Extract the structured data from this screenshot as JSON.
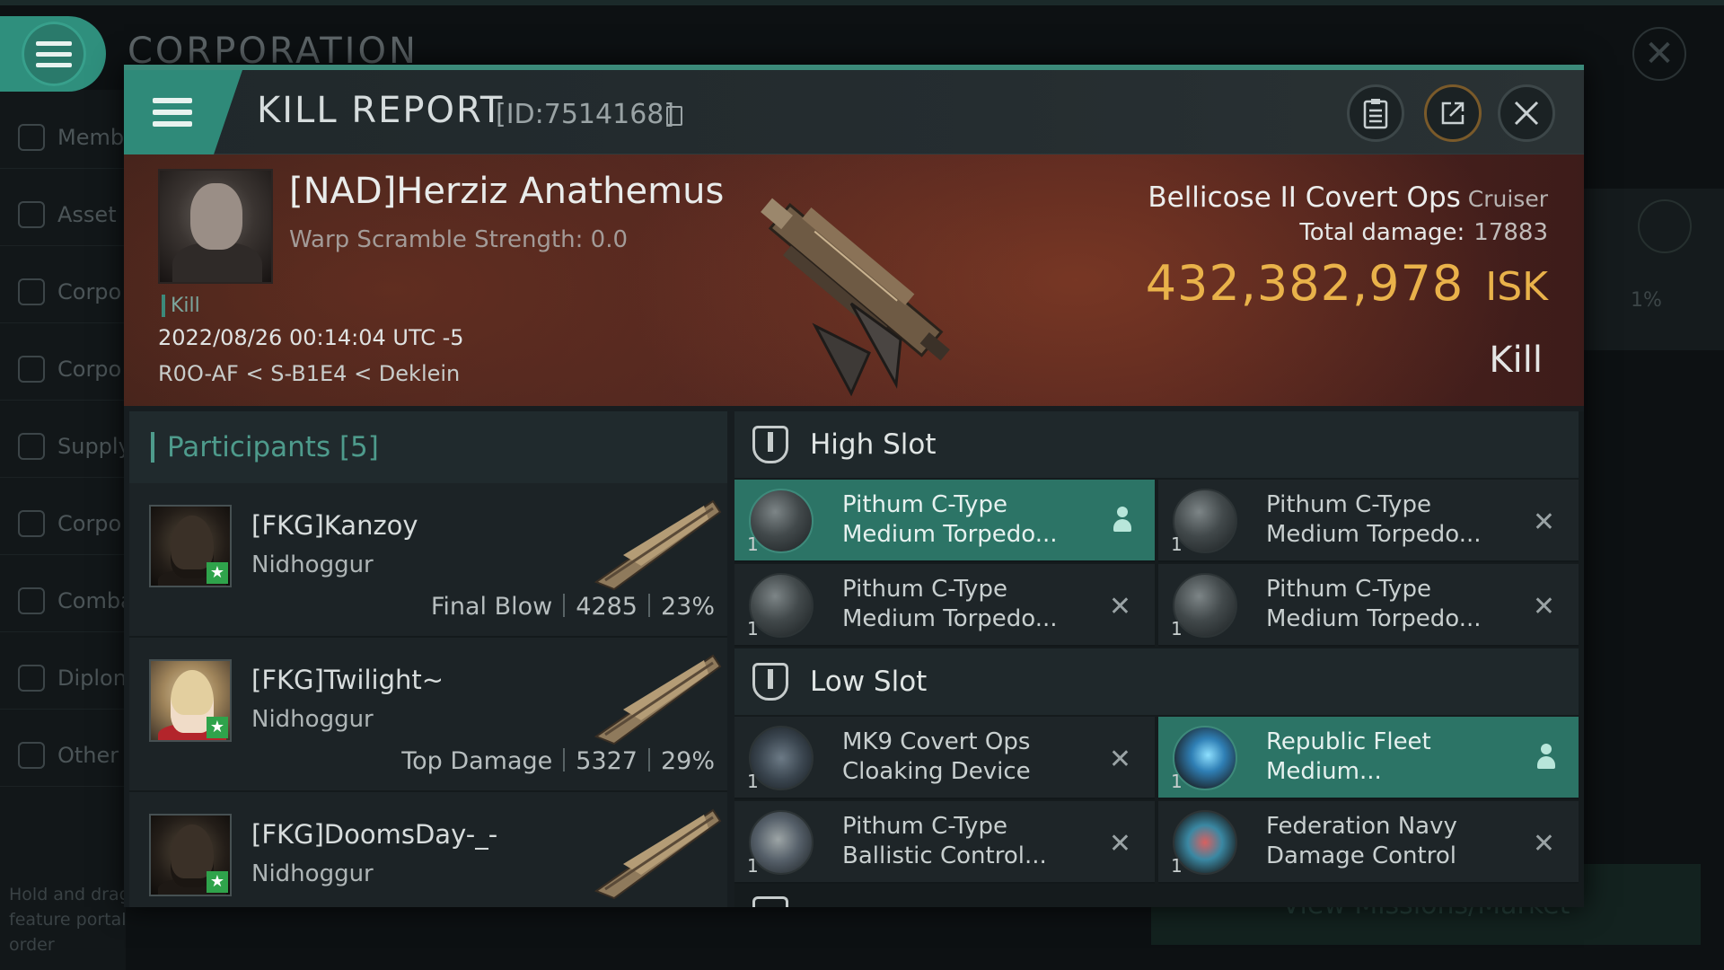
{
  "background": {
    "title": "CORPORATION",
    "nav": [
      {
        "label": "Memb"
      },
      {
        "label": "Asset"
      },
      {
        "label": "Corpo"
      },
      {
        "label": "Corpo"
      },
      {
        "label": "Supply"
      },
      {
        "label": "Corpo"
      },
      {
        "label": "Comba"
      },
      {
        "label": "Diplon"
      },
      {
        "label": "Other"
      }
    ],
    "hint": "Hold and drag feature portal order",
    "percent": "1%",
    "bottom_button": "View Missions/Market"
  },
  "header": {
    "title": "KILL REPORT",
    "id": "[ID:7514168]"
  },
  "victim": {
    "name": "[NAD]Herziz Anathemus",
    "warp": "Warp Scramble Strength: 0.0",
    "tag": "Kill",
    "time": "2022/08/26 00:14:04 UTC -5",
    "location": "R0O-AF < S-B1E4 < Deklein",
    "ship": "Bellicose II Covert Ops",
    "ship_class": "Cruiser",
    "total_damage_label": "Total damage:",
    "total_damage": "17883",
    "isk_value": "432,382,978",
    "isk_unit": "ISK",
    "result": "Kill"
  },
  "participants": {
    "title": "Participants [5]",
    "rows": [
      {
        "name": "[FKG]Kanzoy",
        "ship": "Nidhoggur",
        "role": "Final Blow",
        "damage": "4285",
        "percent": "23%"
      },
      {
        "name": "[FKG]Twilight~",
        "ship": "Nidhoggur",
        "role": "Top Damage",
        "damage": "5327",
        "percent": "29%"
      },
      {
        "name": "[FKG]DoomsDay-_-",
        "ship": "Nidhoggur",
        "role": "",
        "damage": "",
        "percent": ""
      }
    ]
  },
  "fitting": {
    "high_slot_label": "High Slot",
    "low_slot_label": "Low Slot",
    "high": [
      {
        "name": "Pithum C-Type Medium Torpedo...",
        "qty": "1"
      },
      {
        "name": "Pithum C-Type Medium Torpedo...",
        "qty": "1"
      },
      {
        "name": "Pithum C-Type Medium Torpedo...",
        "qty": "1"
      },
      {
        "name": "Pithum C-Type Medium Torpedo...",
        "qty": "1"
      }
    ],
    "low": [
      {
        "name": "MK9 Covert Ops Cloaking Device",
        "qty": "1"
      },
      {
        "name": "Republic Fleet Medium...",
        "qty": "1"
      },
      {
        "name": "Pithum C-Type Ballistic Control...",
        "qty": "1"
      },
      {
        "name": "Federation Navy Damage Control",
        "qty": "1"
      }
    ]
  },
  "colors": {
    "accent": "#2f8a79",
    "isk": "#e9b24a",
    "banner": "#4d2520"
  }
}
